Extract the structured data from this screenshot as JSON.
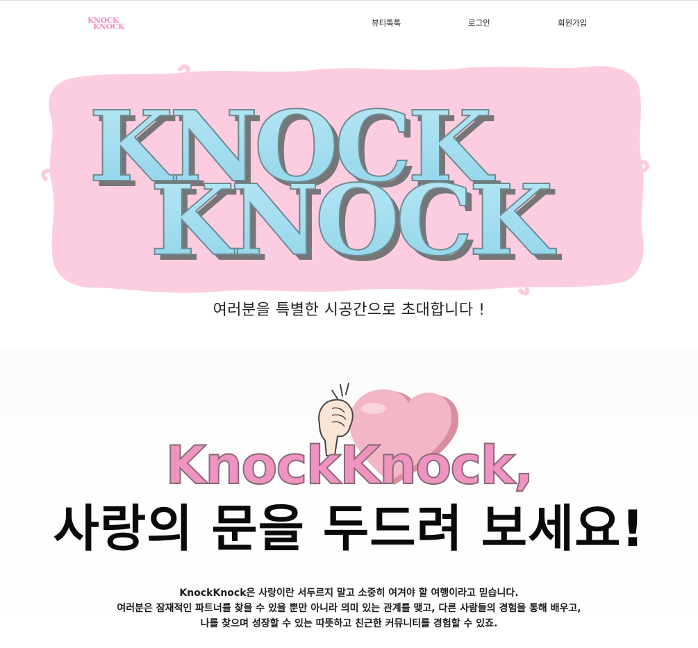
{
  "header": {
    "logo_text_top": "KNOCK",
    "logo_text_bottom": "KNOCK",
    "nav": [
      {
        "label": "뷰티톡톡"
      },
      {
        "label": "로그인"
      },
      {
        "label": "회원가입"
      }
    ]
  },
  "hero": {
    "title_line1": "KNOCK",
    "title_line2": "KNOCK",
    "tagline": "여러분을 특별한 시공간으로 초대합니다 !"
  },
  "intro": {
    "brand_heading": "KnockKnock,",
    "main_heading": "사랑의 문을 두드려 보세요!",
    "description": [
      "KnockKnock은 사랑이란 서두르지 말고 소중히 여겨야 할 여행이라고 믿습니다.",
      "여러분은 잠재적인 파트너를 찾을 수 있을 뿐만 아니라 의미 있는 관계를 맺고, 다른 사람들의 경험을 통해 배우고,",
      "나를 찾으며 성장할 수 있는 따뜻하고 친근한 커뮤니티를 경험할 수 있죠."
    ]
  },
  "colors": {
    "brush_pink": "#fccde0",
    "title_blue": "#9fdcef",
    "title_shadow": "#767676",
    "brand_pink": "#ef94c1",
    "heart_pink": "#f3b6c7"
  }
}
